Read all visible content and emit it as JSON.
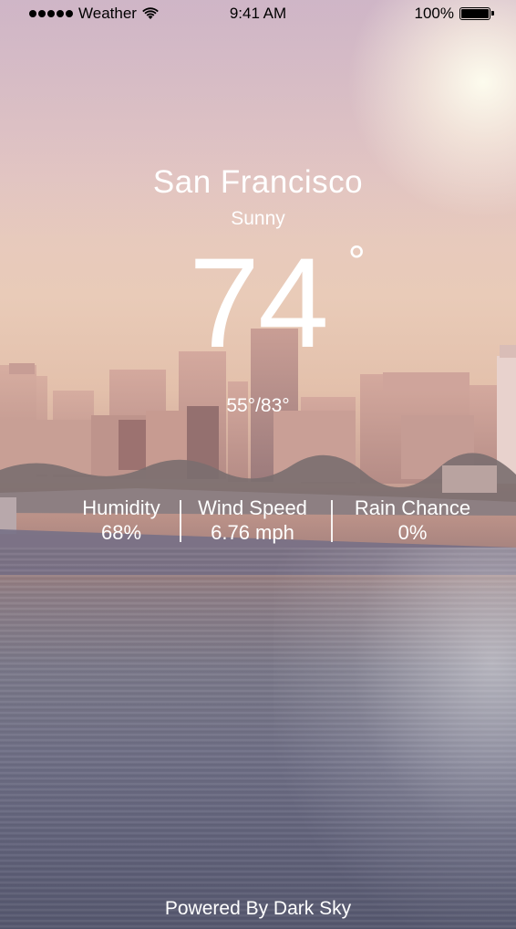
{
  "status_bar": {
    "carrier": "Weather",
    "time": "9:41 AM",
    "battery": "100%"
  },
  "weather": {
    "city": "San Francisco",
    "condition": "Sunny",
    "temperature": "74",
    "degree_symbol": "°",
    "range": "55°/83°"
  },
  "stats": [
    {
      "label": "Humidity",
      "value": "68%"
    },
    {
      "label": "Wind Speed",
      "value": "6.76 mph"
    },
    {
      "label": "Rain Chance",
      "value": "0%"
    }
  ],
  "footer": {
    "attribution": "Powered By Dark Sky"
  },
  "icons": {
    "signal": "signal-dots-icon",
    "wifi": "wifi-icon",
    "battery": "battery-icon"
  }
}
